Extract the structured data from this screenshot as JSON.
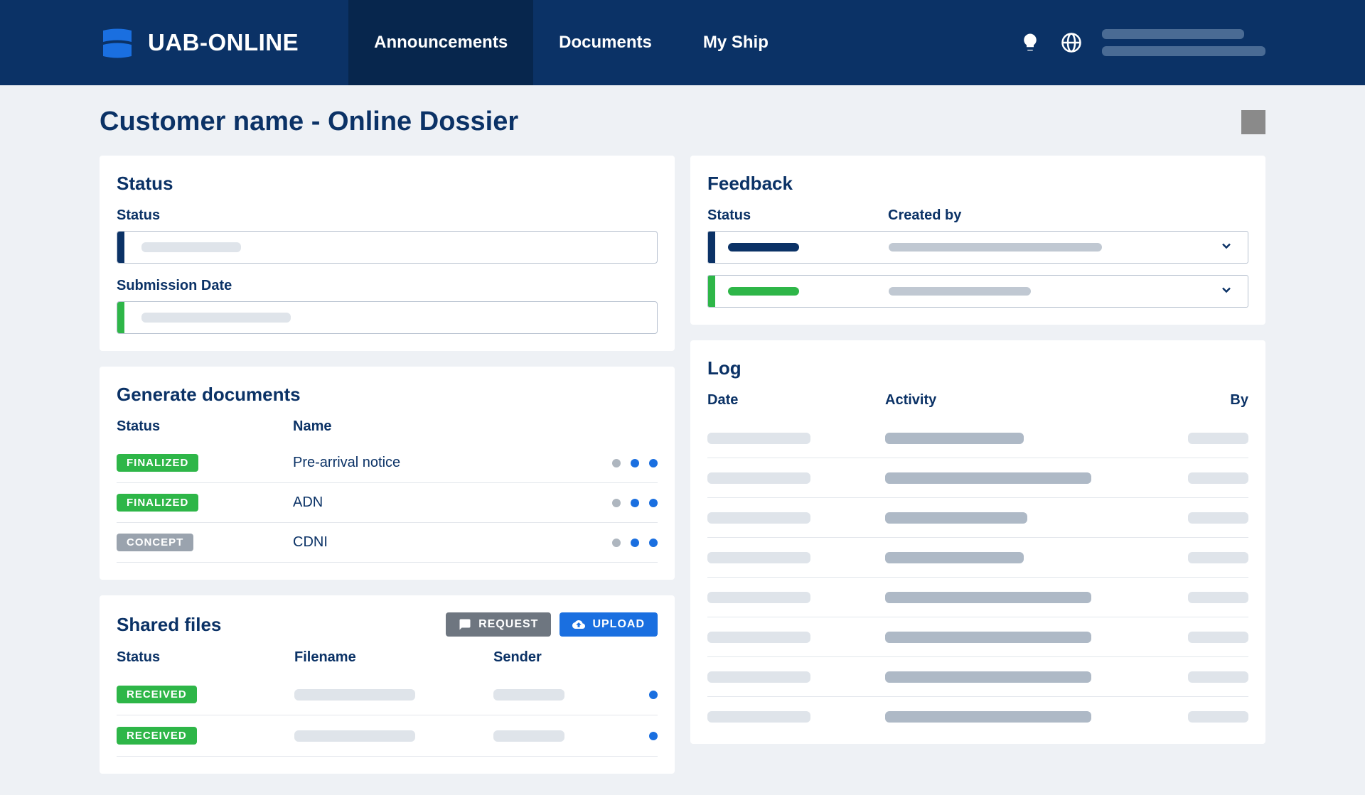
{
  "brand": "UAB-ONLINE",
  "nav": {
    "items": [
      {
        "label": "Announcements",
        "active": true
      },
      {
        "label": "Documents",
        "active": false
      },
      {
        "label": "My Ship",
        "active": false
      }
    ]
  },
  "page": {
    "title": "Customer name - Online Dossier"
  },
  "status_card": {
    "title": "Status",
    "fields": [
      {
        "label": "Status",
        "stripe": "navy"
      },
      {
        "label": "Submission Date",
        "stripe": "green"
      }
    ]
  },
  "generate": {
    "title": "Generate documents",
    "headers": {
      "status": "Status",
      "name": "Name"
    },
    "rows": [
      {
        "badge": "FINALIZED",
        "badge_type": "green",
        "name": "Pre-arrival notice"
      },
      {
        "badge": "FINALIZED",
        "badge_type": "green",
        "name": "ADN"
      },
      {
        "badge": "CONCEPT",
        "badge_type": "grey",
        "name": "CDNI"
      }
    ]
  },
  "shared": {
    "title": "Shared files",
    "request_label": "REQUEST",
    "upload_label": "UPLOAD",
    "headers": {
      "status": "Status",
      "filename": "Filename",
      "sender": "Sender"
    },
    "rows": [
      {
        "badge": "RECEIVED"
      },
      {
        "badge": "RECEIVED"
      }
    ]
  },
  "feedback": {
    "title": "Feedback",
    "headers": {
      "status": "Status",
      "created_by": "Created by"
    },
    "rows": [
      {
        "stripe": "navy",
        "status_color": "navy"
      },
      {
        "stripe": "green",
        "status_color": "green"
      }
    ]
  },
  "log": {
    "title": "Log",
    "headers": {
      "date": "Date",
      "activity": "Activity",
      "by": "By"
    },
    "row_count": 8
  }
}
